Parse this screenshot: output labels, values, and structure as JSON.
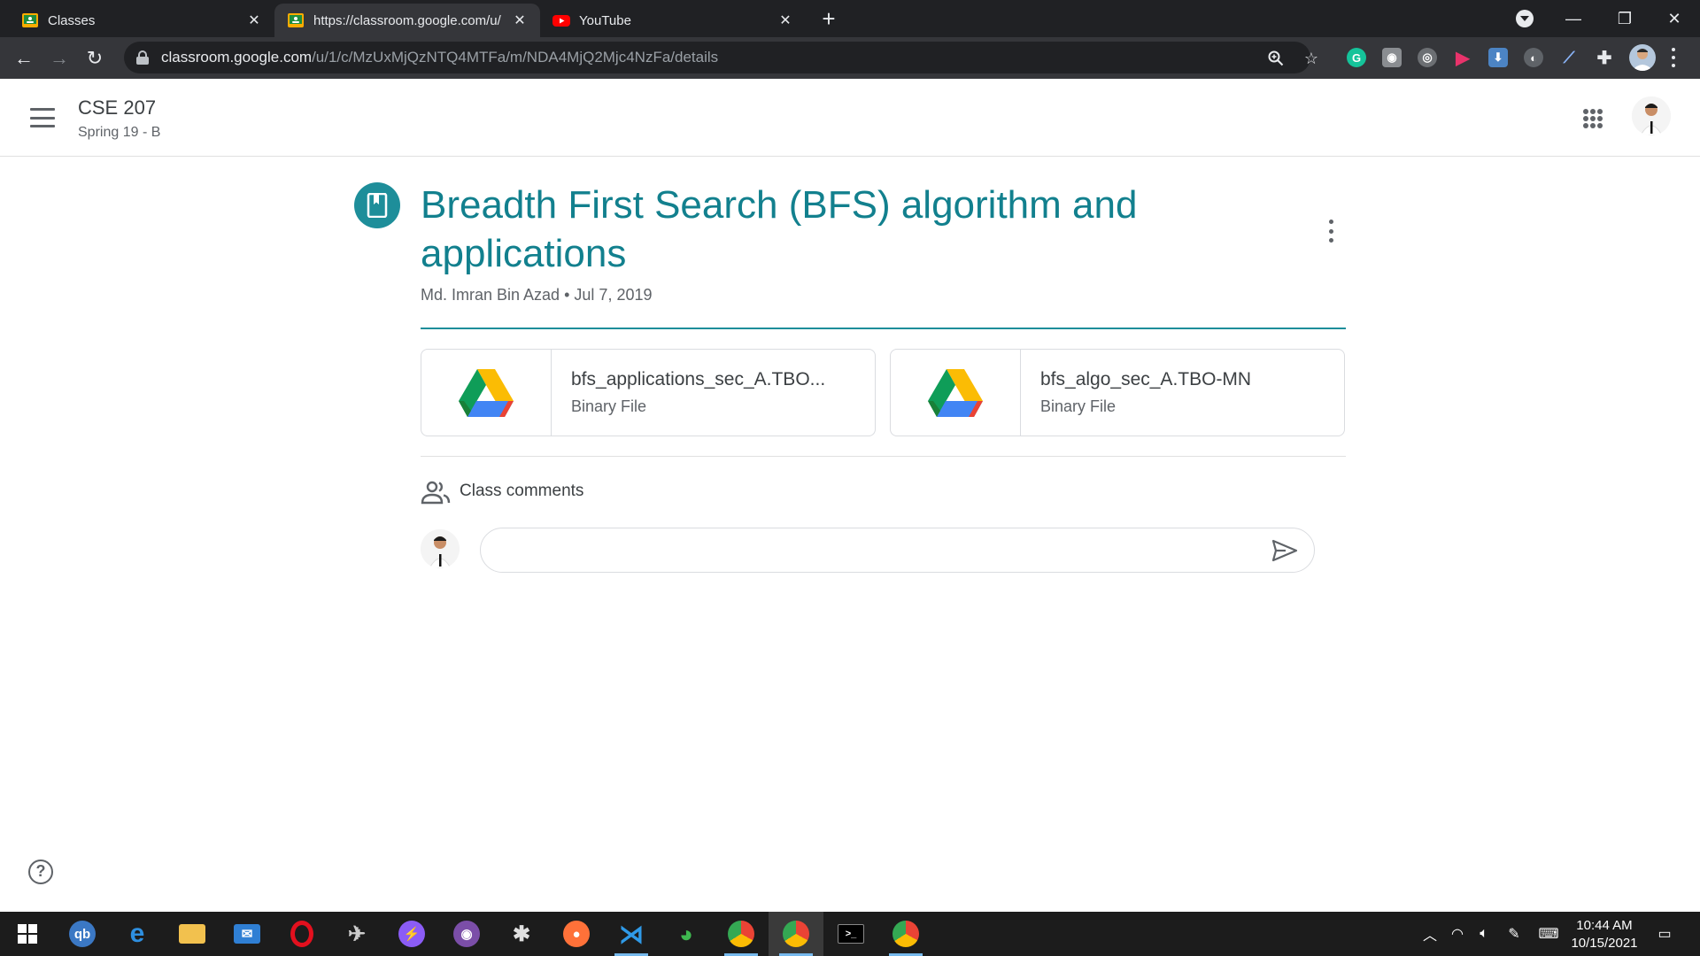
{
  "browser": {
    "tabs": [
      {
        "title": "Classes",
        "active": false
      },
      {
        "title": "https://classroom.google.com/u/",
        "active": true
      },
      {
        "title": "YouTube",
        "active": false
      }
    ],
    "url_host": "classroom.google.com",
    "url_path": "/u/1/c/MzUxMjQzNTQ4MTFa/m/NDA4MjQ2Mjc4NzFa/details"
  },
  "appbar": {
    "course_name": "CSE 207",
    "course_section": "Spring 19 - B"
  },
  "material": {
    "title": "Breadth First Search (BFS) algorithm and applications",
    "author": "Md. Imran Bin Azad",
    "separator": "•",
    "date": "Jul 7, 2019",
    "attachments": [
      {
        "name": "bfs_applications_sec_A.TBO...",
        "type": "Binary File",
        "icon": "google-drive-icon"
      },
      {
        "name": "bfs_algo_sec_A.TBO-MN",
        "type": "Binary File",
        "icon": "google-drive-icon"
      }
    ]
  },
  "comments": {
    "label": "Class comments",
    "placeholder": ""
  },
  "help": {
    "glyph": "?"
  },
  "taskbar": {
    "time": "10:44 AM",
    "date": "10/15/2021"
  },
  "colors": {
    "accent": "#12808e",
    "chrome_dark": "#202124",
    "chrome_toolbar": "#35363a"
  }
}
